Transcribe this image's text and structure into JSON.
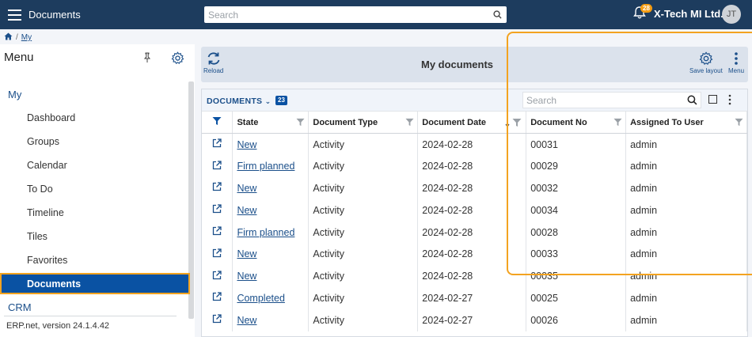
{
  "header": {
    "app_title": "Documents",
    "search_placeholder": "Search",
    "notification_count": "28",
    "company": "X-Tech MI Ltd.",
    "avatar_initials": "JT"
  },
  "breadcrumb": {
    "current": "My"
  },
  "sidebar": {
    "title": "Menu",
    "group_my": "My",
    "items": [
      "Dashboard",
      "Groups",
      "Calendar",
      "To Do",
      "Timeline",
      "Tiles",
      "Favorites"
    ],
    "active_item": "Documents",
    "group_crm": "CRM",
    "version": "ERP.net, version 24.1.4.42"
  },
  "toolbar": {
    "reload_label": "Reload",
    "title": "My documents",
    "save_layout_label": "Save layout",
    "menu_label": "Menu"
  },
  "grid": {
    "label": "DOCUMENTS",
    "count": "23",
    "search_placeholder": "Search",
    "columns": [
      "State",
      "Document Type",
      "Document Date",
      "Document No",
      "Assigned To User"
    ],
    "rows": [
      {
        "state": "New",
        "type": "Activity",
        "date": "2024-02-28",
        "no": "00031",
        "user": "admin"
      },
      {
        "state": "Firm planned",
        "type": "Activity",
        "date": "2024-02-28",
        "no": "00029",
        "user": "admin"
      },
      {
        "state": "New",
        "type": "Activity",
        "date": "2024-02-28",
        "no": "00032",
        "user": "admin"
      },
      {
        "state": "New",
        "type": "Activity",
        "date": "2024-02-28",
        "no": "00034",
        "user": "admin"
      },
      {
        "state": "Firm planned",
        "type": "Activity",
        "date": "2024-02-28",
        "no": "00028",
        "user": "admin"
      },
      {
        "state": "New",
        "type": "Activity",
        "date": "2024-02-28",
        "no": "00033",
        "user": "admin"
      },
      {
        "state": "New",
        "type": "Activity",
        "date": "2024-02-28",
        "no": "00035",
        "user": "admin"
      },
      {
        "state": "Completed",
        "type": "Activity",
        "date": "2024-02-27",
        "no": "00025",
        "user": "admin"
      },
      {
        "state": "New",
        "type": "Activity",
        "date": "2024-02-27",
        "no": "00026",
        "user": "admin"
      }
    ]
  },
  "colors": {
    "topbar": "#1d3c5e",
    "accent": "#0a52a3",
    "highlight": "#f3a320",
    "link": "#1b4f8a"
  }
}
